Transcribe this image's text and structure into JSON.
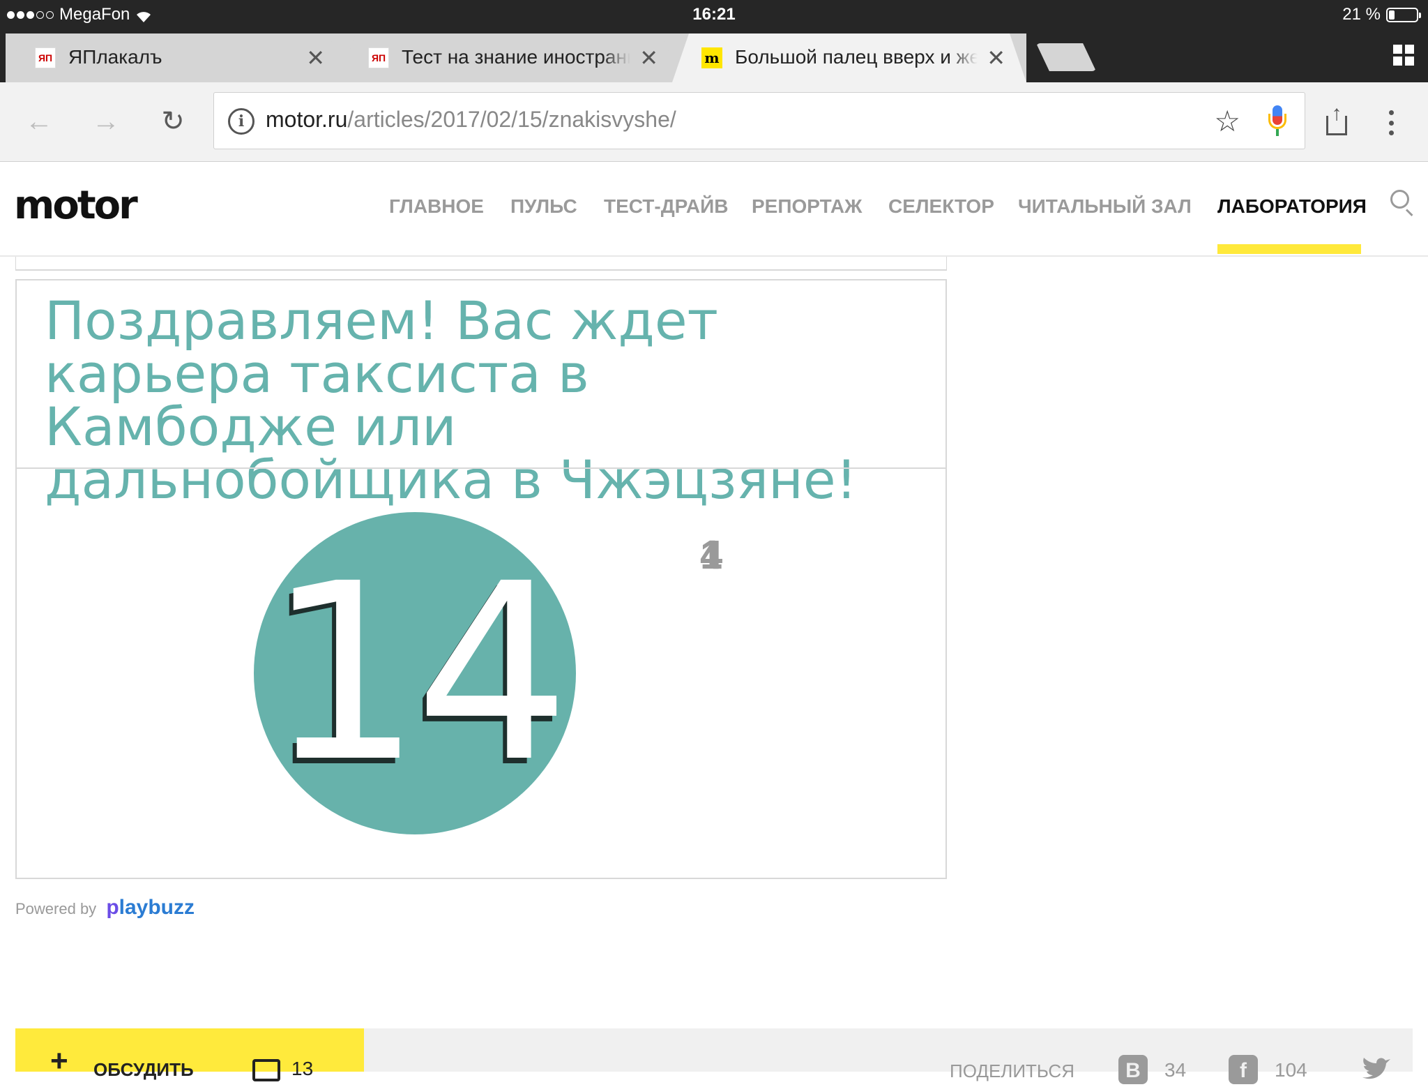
{
  "status_bar": {
    "carrier": "MegaFon",
    "time": "16:21",
    "battery": "21 %",
    "battery_level": 0.21
  },
  "tabs": [
    {
      "title": "ЯПлакалъ",
      "favicon": "yap-favicon",
      "favicon_text": "ЯП",
      "active": false
    },
    {
      "title": "Тест на знание иностранных",
      "favicon": "yap-favicon",
      "favicon_text": "ЯП",
      "active": false
    },
    {
      "title": "Большой палец вверх и жест",
      "favicon": "motor-favicon",
      "favicon_text": "m",
      "active": true
    }
  ],
  "toolbar": {
    "url_domain": "motor.ru",
    "url_path": "/articles/2017/02/15/znakisvyshe/"
  },
  "site": {
    "logo": "motor",
    "nav": [
      "ГЛАВНОЕ",
      "ПУЛЬС",
      "ТЕСТ-ДРАЙВ",
      "РЕПОРТАЖ",
      "СЕЛЕКТОР",
      "ЧИТАЛЬНЫЙ ЗАЛ",
      "ЛАБОРАТОРИЯ"
    ],
    "nav_active_index": 6,
    "accent_color": "#ffe93b"
  },
  "quiz": {
    "result_title": "Поздравляем! Вас ждет карьера таксиста в Камбодже или дальнобойщика в Чжэцзяне!",
    "score": "14",
    "glitch_a": "1",
    "glitch_b": "4",
    "title_color": "#66b3ad",
    "circle_color": "#67b2ab"
  },
  "powered": {
    "label": "Powered by",
    "brand_p": "p",
    "brand_rest": "laybuzz"
  },
  "bottom": {
    "discuss_label": "ОБСУДИТЬ",
    "comments": "13",
    "share_label": "ПОДЕЛИТЬСЯ",
    "vk_letter": "B",
    "vk_count": "34",
    "fb_letter": "f",
    "fb_count": "104"
  }
}
